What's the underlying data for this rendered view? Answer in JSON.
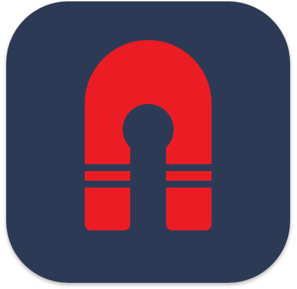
{
  "app_icon": {
    "icon_name": "magnet-icon",
    "colors": {
      "background": "#2d3a56",
      "glyph": "#ec1c24"
    }
  }
}
